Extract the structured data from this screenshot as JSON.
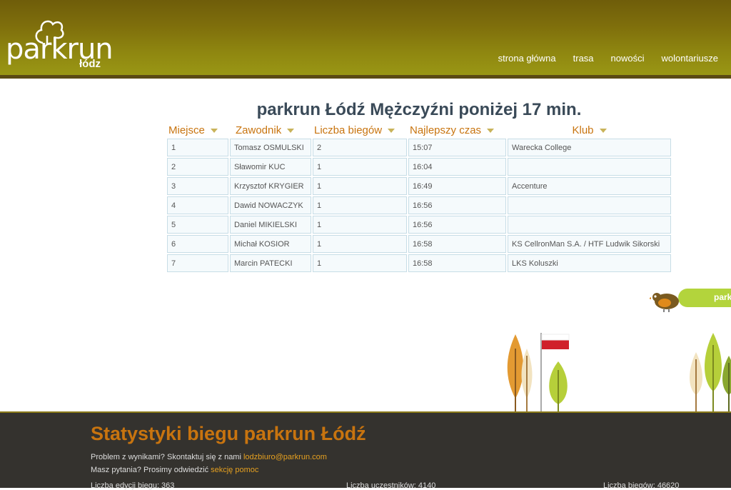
{
  "header": {
    "logo_text": "parkrun",
    "logo_city": "łódz",
    "nav": [
      "strona główna",
      "trasa",
      "nowości",
      "wolontariusze"
    ]
  },
  "main": {
    "title": "parkrun Łódź Mężczyźni poniżej 17 min.",
    "columns": [
      "Miejsce",
      "Zawodnik",
      "Liczba biegów",
      "Najlepszy czas",
      "Klub"
    ],
    "rows": [
      [
        "1",
        "Tomasz OSMULSKI",
        "2",
        "15:07",
        "Warecka College"
      ],
      [
        "2",
        "Sławomir KUC",
        "1",
        "16:04",
        ""
      ],
      [
        "3",
        "Krzysztof KRYGIER",
        "1",
        "16:49",
        "Accenture"
      ],
      [
        "4",
        "Dawid NOWACZYK",
        "1",
        "16:56",
        ""
      ],
      [
        "5",
        "Daniel MIKIELSKI",
        "1",
        "16:56",
        ""
      ],
      [
        "6",
        "Michał KOSIOR",
        "1",
        "16:58",
        "KS CellronMan S.A. / HTF Ludwik Sikorski"
      ],
      [
        "7",
        "Marcin PATECKI",
        "1",
        "16:58",
        "LKS Koluszki"
      ]
    ]
  },
  "decor": {
    "banner_text": "park"
  },
  "footer": {
    "title": "Statystyki biegu parkrun Łódź",
    "line1_text": "Problem z wynikami? Skontaktuj się z nami ",
    "line1_link": "lodzbiuro@parkrun.com",
    "line2_text": "Masz pytania? Prosimy odwiedzić ",
    "line2_link": "sekcję pomoc",
    "stat_events": "Liczba edycji biegu: 363",
    "stat_participants": "Liczba uczestników: 4140",
    "stat_runs": "Liczba biegów: 46620"
  },
  "colors": {
    "accent": "#c8740f",
    "header": "#8a7e10",
    "footer": "#34322e"
  }
}
